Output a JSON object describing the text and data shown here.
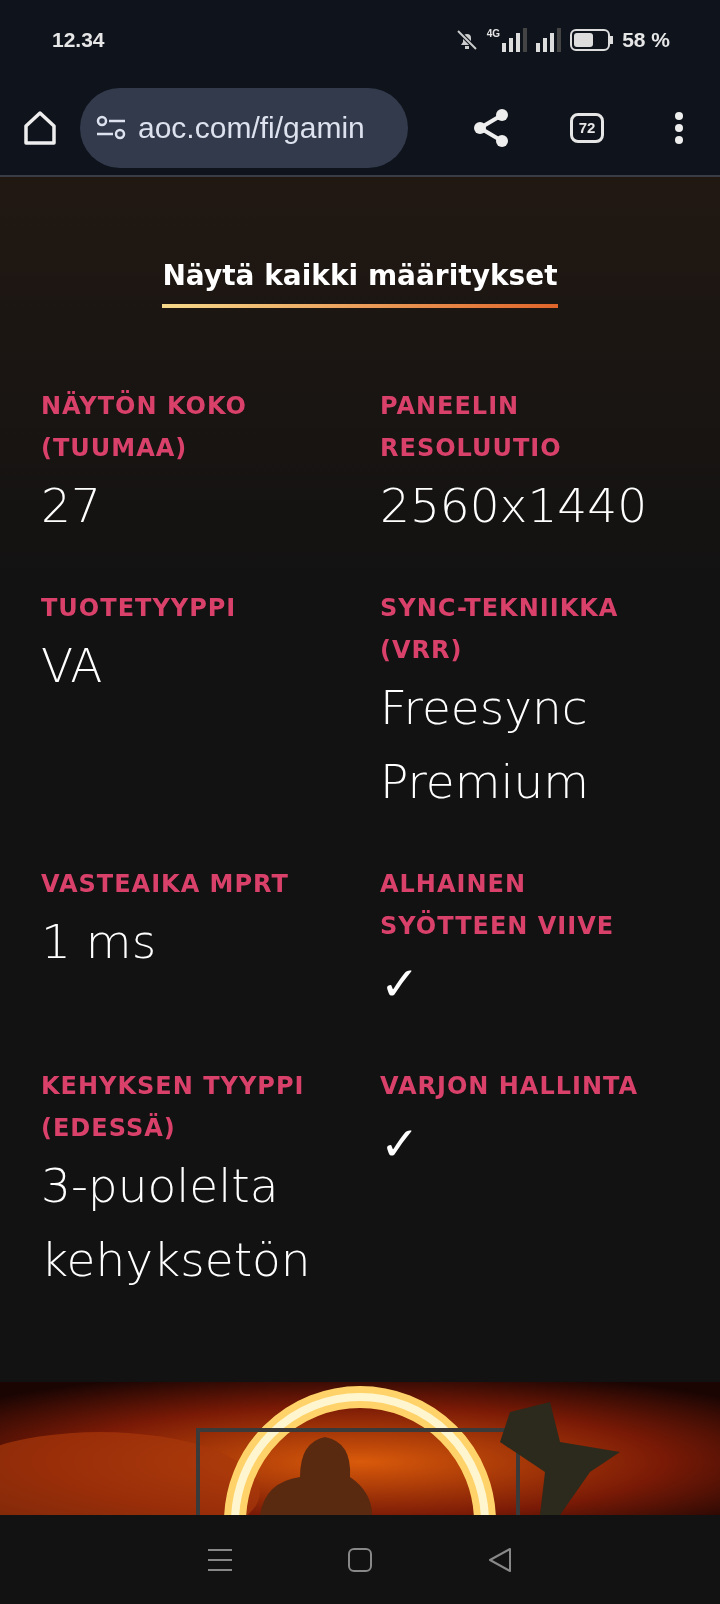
{
  "status_bar": {
    "time": "12.34",
    "battery_percent": "58 %",
    "network": "4G"
  },
  "browser": {
    "url": "aoc.com/fi/gamin",
    "tab_count": "72"
  },
  "heading": "Näytä kaikki määritykset",
  "specs": [
    {
      "label": "NÄYTÖN KOKO (TUUMAA)",
      "value": "27"
    },
    {
      "label": "PANEELIN RESOLUUTIO",
      "value": "2560x1440"
    },
    {
      "label": "TUOTETYYPPI",
      "value": "VA"
    },
    {
      "label": "SYNC-TEKNIIKKA (VRR)",
      "value": "Freesync Premium"
    },
    {
      "label": "VASTEAIKA MPRT",
      "value": "1 ms"
    },
    {
      "label": "ALHAINEN SYÖTTEEN VIIVE",
      "value": "✓"
    },
    {
      "label": "KEHYKSEN TYYPPI (EDESSÄ)",
      "value": "3-puolelta kehyksetön"
    },
    {
      "label": "VARJON HALLINTA",
      "value": "✓"
    }
  ]
}
